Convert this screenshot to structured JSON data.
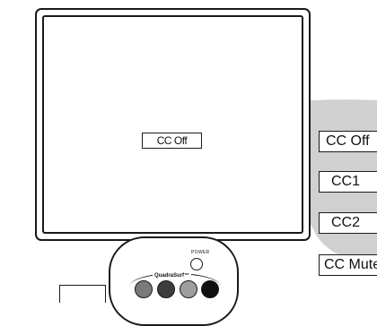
{
  "tv": {
    "osd_label": "CC Off"
  },
  "cc_options": [
    {
      "label": "CC Off"
    },
    {
      "label": "CC1"
    },
    {
      "label": "CC2"
    },
    {
      "label": "CC Mute"
    }
  ],
  "remote": {
    "power_label": "POWER",
    "brand": "QuadraSurf™",
    "button_colors": [
      "#7a7a7a",
      "#3d3d3d",
      "#9e9e9e",
      "#101010"
    ]
  },
  "colors": {
    "beam": "#d0d0d0",
    "outline": "#1a1a1a"
  }
}
